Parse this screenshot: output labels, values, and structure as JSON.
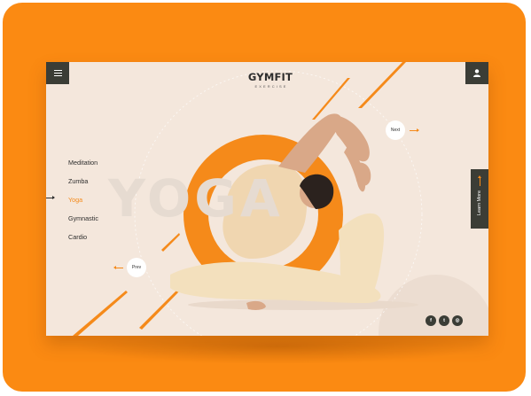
{
  "brand": {
    "name_main": "GYM",
    "name_accent": "FIT",
    "tagline": "EXERCISE"
  },
  "hero": {
    "background_word": "YOGA",
    "image_description_icon": "yoga-pose-figure"
  },
  "nav": {
    "items": [
      {
        "label": "Meditation",
        "active": false
      },
      {
        "label": "Zumba",
        "active": false
      },
      {
        "label": "Yoga",
        "active": true
      },
      {
        "label": "Gymnastic",
        "active": false
      },
      {
        "label": "Cardio",
        "active": false
      }
    ]
  },
  "slider": {
    "next_label": "Next",
    "prev_label": "Prev"
  },
  "cta": {
    "learn_more_label": "Learn More"
  },
  "header": {
    "menu_icon": "hamburger-icon",
    "user_icon": "user-icon"
  },
  "social": {
    "items": [
      {
        "icon": "facebook-icon",
        "glyph": "f"
      },
      {
        "icon": "twitter-icon",
        "glyph": "t"
      },
      {
        "icon": "instagram-icon",
        "glyph": "◎"
      }
    ]
  },
  "colors": {
    "accent": "#f58a1a",
    "frame": "#fb8a12",
    "card_bg": "#f4e7dc",
    "dark": "#3b3d36"
  }
}
